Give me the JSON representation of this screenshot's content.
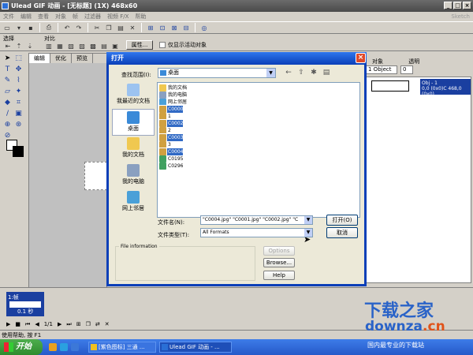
{
  "app": {
    "title": "Ulead GIF 动画 - [无标题] (1X) 468x60",
    "menu": [
      "文件",
      "编辑",
      "查看",
      "对象",
      "帧",
      "过滤器",
      "视频 F/X",
      "帮助"
    ],
    "menu_right": "Sketch",
    "toolbar2": {
      "label_a": "选择",
      "label_b": "对比",
      "properties_label": "属性...",
      "checkbox_label": "仅显示活动对象"
    },
    "doc_tabs": [
      "编辑",
      "优化",
      "预览"
    ],
    "right_panel": {
      "label_a": "对象",
      "label_b": "透明",
      "object_select": "1 Object",
      "opacity_value": "0",
      "row_line1": "Obj - 1",
      "row_line2": "0,0 (0x0)C 468,0 (0x0)"
    },
    "timeline": {
      "frame_label": "1:帧",
      "frame_caption": "0.1 秒",
      "counter": "1/1"
    },
    "status": "使用帮助, 按 F1"
  },
  "taskbar": {
    "start": "开始",
    "items": [
      {
        "label": "[紫色图标] 三通 ...",
        "active": false
      },
      {
        "label": "Ulead GIF 动画 - ...",
        "active": true
      }
    ]
  },
  "watermark": {
    "brand_cn": "下载之家",
    "brand_en_a": "downza",
    "brand_en_b": ".cn",
    "tagline": "国内最专业的下载站"
  },
  "dialog": {
    "title": "打开",
    "look_in_label": "查找范围(I):",
    "look_in_value": "桌面",
    "places": [
      "我最近的文档",
      "桌面",
      "我的文档",
      "我的电脑",
      "网上邻居"
    ],
    "files": [
      {
        "name": "我的文档",
        "sel": false
      },
      {
        "name": "我的电脑",
        "sel": false
      },
      {
        "name": "网上邻居",
        "sel": false
      },
      {
        "name": "C0000",
        "sel": true
      },
      {
        "name": "1",
        "sel": false
      },
      {
        "name": "C0002",
        "sel": true
      },
      {
        "name": "2",
        "sel": false
      },
      {
        "name": "C0003",
        "sel": true
      },
      {
        "name": "3",
        "sel": false
      },
      {
        "name": "C0004",
        "sel": true
      },
      {
        "name": "C0195",
        "sel": false
      },
      {
        "name": "C0296",
        "sel": false
      }
    ],
    "filename_label": "文件名(N):",
    "filename_value": "\"C0004.jpg\" \"C0001.jpg\" \"C0002.jpg\" \"C",
    "filetype_label": "文件类型(T):",
    "filetype_value": "All Formats",
    "open_button": "打开(O)",
    "cancel_button": "取消",
    "fileinfo_legend": "File information",
    "options_button": "Options",
    "browse_button": "Browse...",
    "help_button": "Help"
  }
}
